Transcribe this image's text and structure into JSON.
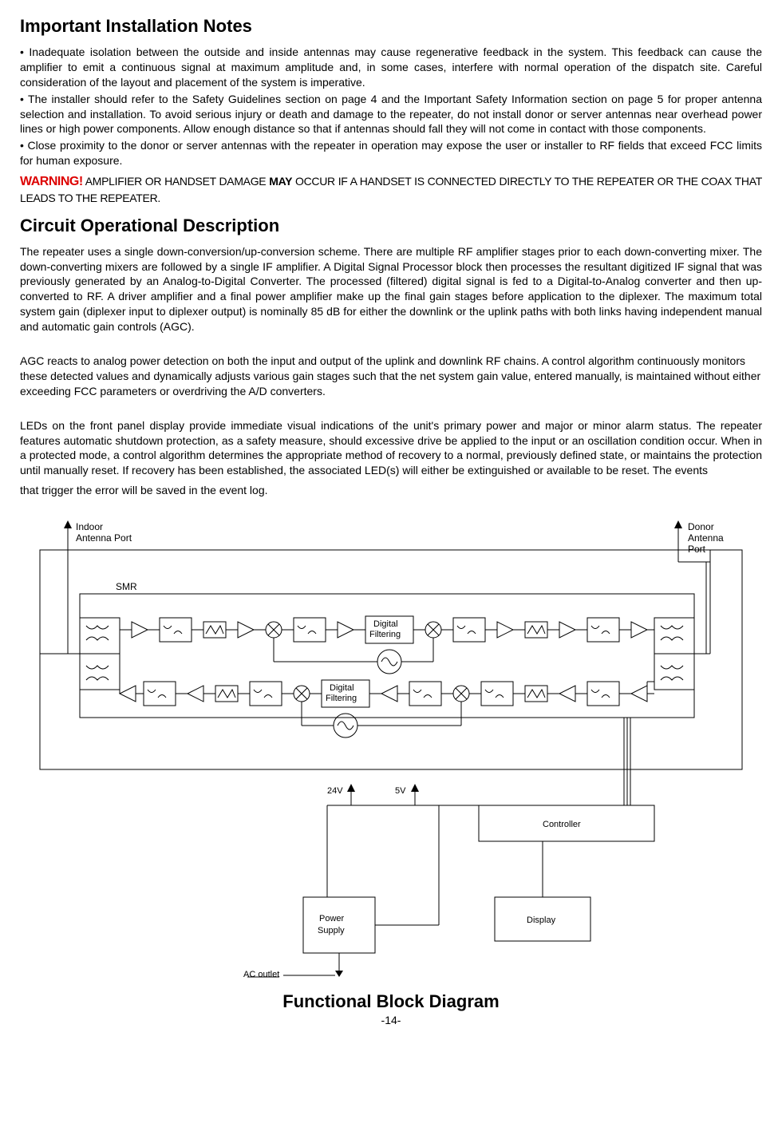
{
  "heading1": "Important Installation Notes",
  "bullet1": "•       Inadequate isolation between the outside and inside antennas may cause regenerative feedback in the system. This feedback can cause the amplifier to emit a continuous signal at maximum amplitude and, in some cases, interfere with normal operation of the dispatch site. Careful consideration of the layout and placement of the system is imperative.",
  "bullet2": "•     The installer should refer to the Safety Guidelines section on page 4 and the Important Safety Information section on page 5 for proper antenna selection and installation. To avoid serious injury or death and damage to the repeater, do not install donor or server antennas near overhead power lines or high power components.   Allow enough distance so that if antennas should fall they will not come in contact  with those components.",
  "bullet3": "•     Close proximity  to the donor or server antennas with the repeater in operation may expose the user or installer to RF fields that exceed FCC limits for human exposure.",
  "warningLabel": "WARNING!",
  "warningText1": " AMPLIFIER OR HANDSET DAMAGE ",
  "warningBold": "MAY",
  "warningText2": " OCCUR IF A HANDSET IS CONNECTED DIRECTLY TO THE REPEATER OR THE COAX THAT LEADS TO THE REPEATER.",
  "heading2": "Circuit Operational Description",
  "para1": "The repeater uses a single down-conversion/up-conversion scheme. There are multiple  RF amplifier stages prior to each down-converting mixer. The down-converting mixers are followed by a single IF amplifier. A Digital Signal Processor block then processes the resultant digitized IF signal that was previously generated by an Analog-to-Digital Converter. The processed (filtered) digital signal is fed to a Digital-to-Analog converter and then up-converted to RF. A driver amplifier and a final power amplifier make up the final gain stages before application to the diplexer. The maximum total system gain (diplexer input to diplexer output) is nominally 85 dB for either the downlink  or the uplink paths with both links having independent manual and automatic gain controls (AGC).",
  "para2": "AGC reacts to analog power detection on both the input and output of the uplink and downlink RF chains. A control algorithm continuously monitors these detected values and dynamically adjusts various gain stages  such that the net system gain value, entered manually, is maintained without either exceeding FCC parameters or overdriving the A/D converters.",
  "para3": "LEDs on the front panel display provide immediate visual indications of the unit's primary power and major or minor alarm status. The repeater features automatic shutdown protection, as a safety measure, should excessive drive be applied to the input or an oscillation condition occur. When in a protected mode, a control algorithm determines the appropriate method of recovery to a normal, previously defined state, or maintains the protection until manually reset. If recovery has been established, the associated LED(s) will either be extinguished or available to be reset. The events",
  "para3b": "that trigger the error will be saved in the event log.",
  "diagram": {
    "indoorLabel1": "Indoor",
    "indoorLabel2": "Antenna Port",
    "donorLabel1": "Donor",
    "donorLabel2": "Antenna",
    "donorLabel3": "Port",
    "smr": "SMR",
    "digitalFiltering1a": "Digital",
    "digitalFiltering1b": "Filtering",
    "digitalFiltering2a": "Digital",
    "digitalFiltering2b": "Filtering",
    "v24": "24V",
    "v5": "5V",
    "controller": "Controller",
    "power1": "Power",
    "power2": "Supply",
    "display": "Display",
    "acOutlet": "AC outlet"
  },
  "diagramTitle": "Functional Block Diagram",
  "pageNum": "-14-"
}
